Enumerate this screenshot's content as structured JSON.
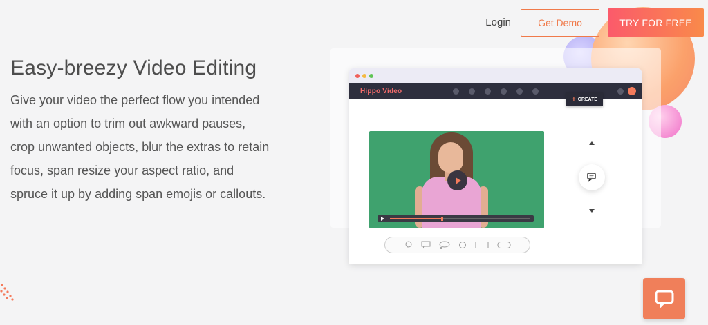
{
  "nav": {
    "login_label": "Login",
    "demo_label": "Get Demo",
    "try_label": "TRY FOR FREE"
  },
  "hero": {
    "title": "Easy-breezy Video Editing",
    "description": "Give your video the perfect flow you intended with an option to trim out awkward pauses, crop unwanted objects, blur the extras to retain focus, span resize your aspect ratio, and spruce it up by adding span emojis or callouts."
  },
  "mockup": {
    "logo_text": "Hippo Video",
    "create_label": "CREATE",
    "video_progress": 0.37,
    "shape_icons": [
      "speech-bubble-round-icon",
      "speech-bubble-square-icon",
      "cloud-bubble-icon",
      "circle-icon",
      "rectangle-icon",
      "rounded-rectangle-icon"
    ]
  },
  "colors": {
    "accent": "#f07a4a",
    "try_gradient_start": "#fb5a6b",
    "try_gradient_end": "#f98a4a",
    "appbar": "#2e2f3e",
    "video_bg": "#3fa26e",
    "chat_button": "#f07f5a"
  }
}
